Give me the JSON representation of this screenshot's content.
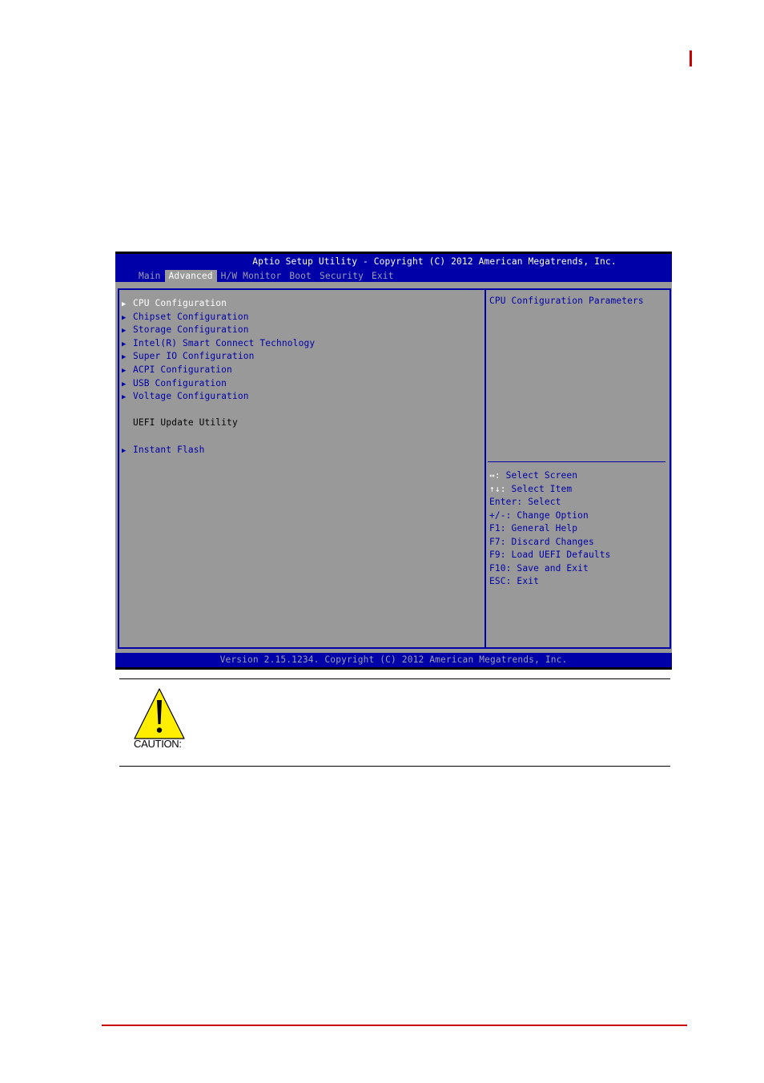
{
  "bios": {
    "title": "Aptio Setup Utility - Copyright (C) 2012 American Megatrends, Inc.",
    "tabs": [
      {
        "label": "Main",
        "active": false
      },
      {
        "label": "Advanced",
        "active": true
      },
      {
        "label": "H/W Monitor",
        "active": false
      },
      {
        "label": "Boot",
        "active": false
      },
      {
        "label": "Security",
        "active": false
      },
      {
        "label": "Exit",
        "active": false
      }
    ],
    "menu_items": [
      {
        "label": "CPU Configuration",
        "selected": true
      },
      {
        "label": "Chipset Configuration"
      },
      {
        "label": "Storage Configuration"
      },
      {
        "label": "Intel(R) Smart Connect Technology"
      },
      {
        "label": "Super IO Configuration"
      },
      {
        "label": "ACPI Configuration"
      },
      {
        "label": "USB Configuration"
      },
      {
        "label": "Voltage Configuration"
      }
    ],
    "section_label": "UEFI Update Utility",
    "instant_flash": "Instant Flash",
    "arrow_glyph": "▶",
    "help_text": "CPU Configuration Parameters",
    "keys": [
      {
        "key": "↔:",
        "desc": " Select Screen"
      },
      {
        "key": "↑↓:",
        "desc": " Select Item"
      },
      {
        "key": "Enter:",
        "desc": " Select"
      },
      {
        "key": "+/-:",
        "desc": " Change Option"
      },
      {
        "key": "F1:",
        "desc": " General Help"
      },
      {
        "key": "F7:",
        "desc": " Discard Changes"
      },
      {
        "key": "F9:",
        "desc": " Load UEFI Defaults"
      },
      {
        "key": "F10:",
        "desc": " Save and Exit"
      },
      {
        "key": "ESC:",
        "desc": " Exit"
      }
    ],
    "footer": "Version 2.15.1234. Copyright (C) 2012 American Megatrends, Inc."
  },
  "caution": {
    "label": "CAUTION:"
  },
  "colors": {
    "bios_blue": "#0000a8",
    "bios_gray": "#999999",
    "accent_red": "#cc0000",
    "caution_yellow": "#ffee00"
  }
}
